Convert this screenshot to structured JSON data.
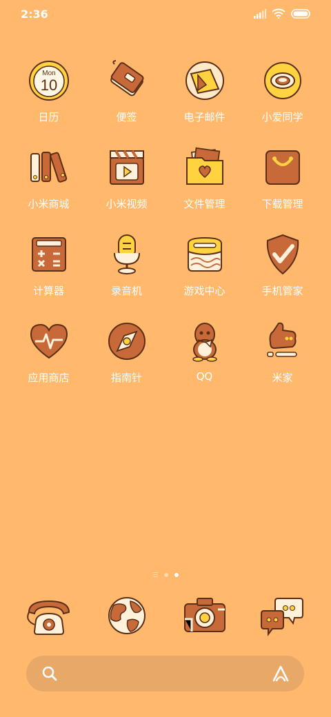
{
  "status_bar": {
    "time": "2:36"
  },
  "apps": [
    {
      "label": "日历",
      "icon": "calendar-icon",
      "date_day": "Mon",
      "date_num": "10"
    },
    {
      "label": "便签",
      "icon": "notes-icon"
    },
    {
      "label": "电子邮件",
      "icon": "email-icon"
    },
    {
      "label": "小爱同学",
      "icon": "xiaoai-icon"
    },
    {
      "label": "小米商城",
      "icon": "mi-store-icon"
    },
    {
      "label": "小米视频",
      "icon": "mi-video-icon"
    },
    {
      "label": "文件管理",
      "icon": "file-manager-icon"
    },
    {
      "label": "下载管理",
      "icon": "downloads-icon"
    },
    {
      "label": "计算器",
      "icon": "calculator-icon"
    },
    {
      "label": "录音机",
      "icon": "recorder-icon"
    },
    {
      "label": "游戏中心",
      "icon": "game-center-icon"
    },
    {
      "label": "手机管家",
      "icon": "security-icon"
    },
    {
      "label": "应用商店",
      "icon": "app-store-icon"
    },
    {
      "label": "指南针",
      "icon": "compass-icon"
    },
    {
      "label": "QQ",
      "icon": "qq-icon"
    },
    {
      "label": "米家",
      "icon": "mi-home-icon"
    }
  ],
  "dock": [
    {
      "icon": "phone-icon"
    },
    {
      "icon": "browser-icon"
    },
    {
      "icon": "camera-icon"
    },
    {
      "icon": "messages-icon"
    }
  ],
  "page_indicator": {
    "pages": 3,
    "active": 3
  },
  "colors": {
    "background": "#FFB86C",
    "icon_brown": "#C8693A",
    "icon_yellow": "#FFD23F",
    "outline": "#5A2E14"
  }
}
